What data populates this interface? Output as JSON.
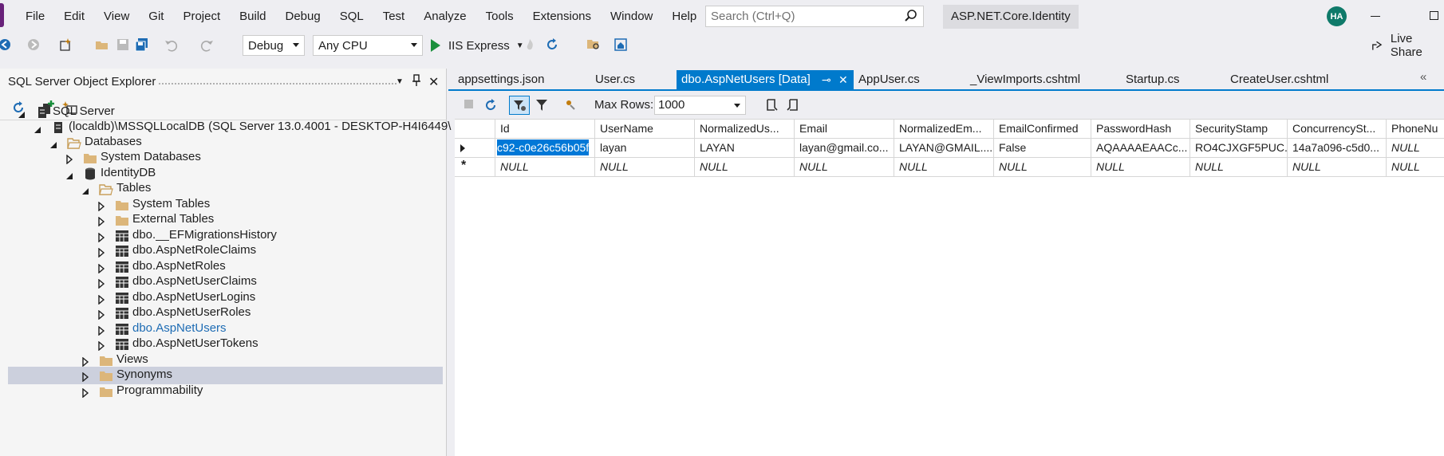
{
  "menu": {
    "items": [
      "File",
      "Edit",
      "View",
      "Git",
      "Project",
      "Build",
      "Debug",
      "SQL",
      "Test",
      "Analyze",
      "Tools",
      "Extensions",
      "Window",
      "Help"
    ],
    "search_placeholder": "Search (Ctrl+Q)",
    "solution_name": "ASP.NET.Core.Identity",
    "avatar_initials": "HA"
  },
  "toolbar": {
    "config": "Debug",
    "platform": "Any CPU",
    "run_target": "IIS Express",
    "live_share": "Live Share"
  },
  "explorer": {
    "title": "SQL Server Object Explorer",
    "tree": [
      {
        "label": "SQL Server",
        "level": 0,
        "icon": "server-icon",
        "state": "expanded"
      },
      {
        "label": "(localdb)\\MSSQLLocalDB (SQL Server 13.0.4001 - DESKTOP-H4I6449\\",
        "level": 1,
        "icon": "server-icon",
        "state": "expanded"
      },
      {
        "label": "Databases",
        "level": 2,
        "icon": "folder-open-icon",
        "state": "expanded"
      },
      {
        "label": "System Databases",
        "level": 3,
        "icon": "folder-icon",
        "state": "collapsed"
      },
      {
        "label": "IdentityDB",
        "level": 3,
        "icon": "database-icon",
        "state": "expanded"
      },
      {
        "label": "Tables",
        "level": 4,
        "icon": "folder-open-icon",
        "state": "expanded"
      },
      {
        "label": "System Tables",
        "level": 5,
        "icon": "folder-icon",
        "state": "collapsed"
      },
      {
        "label": "External Tables",
        "level": 5,
        "icon": "folder-icon",
        "state": "collapsed"
      },
      {
        "label": "dbo.__EFMigrationsHistory",
        "level": 5,
        "icon": "table-icon",
        "state": "collapsed"
      },
      {
        "label": "dbo.AspNetRoleClaims",
        "level": 5,
        "icon": "table-icon",
        "state": "collapsed"
      },
      {
        "label": "dbo.AspNetRoles",
        "level": 5,
        "icon": "table-icon",
        "state": "collapsed"
      },
      {
        "label": "dbo.AspNetUserClaims",
        "level": 5,
        "icon": "table-icon",
        "state": "collapsed"
      },
      {
        "label": "dbo.AspNetUserLogins",
        "level": 5,
        "icon": "table-icon",
        "state": "collapsed"
      },
      {
        "label": "dbo.AspNetUserRoles",
        "level": 5,
        "icon": "table-icon",
        "state": "collapsed"
      },
      {
        "label": "dbo.AspNetUsers",
        "level": 5,
        "icon": "table-icon",
        "state": "collapsed",
        "highlight": true
      },
      {
        "label": "dbo.AspNetUserTokens",
        "level": 5,
        "icon": "table-icon",
        "state": "collapsed"
      },
      {
        "label": "Views",
        "level": 4,
        "icon": "folder-icon",
        "state": "collapsed"
      },
      {
        "label": "Synonyms",
        "level": 4,
        "icon": "folder-icon",
        "state": "collapsed",
        "selected": true
      },
      {
        "label": "Programmability",
        "level": 4,
        "icon": "folder-icon",
        "state": "collapsed"
      }
    ]
  },
  "tabs": [
    {
      "label": "appsettings.json"
    },
    {
      "label": "User.cs"
    },
    {
      "label": "dbo.AspNetUsers [Data]",
      "active": true
    },
    {
      "label": "AppUser.cs"
    },
    {
      "label": "_ViewImports.cshtml"
    },
    {
      "label": "Startup.cs"
    },
    {
      "label": "CreateUser.cshtml"
    }
  ],
  "editor": {
    "max_rows_label": "Max Rows:",
    "max_rows_value": "1000",
    "columns": [
      "Id",
      "UserName",
      "NormalizedUs...",
      "Email",
      "NormalizedEm...",
      "EmailConfirmed",
      "PasswordHash",
      "SecurityStamp",
      "ConcurrencySt...",
      "PhoneNu"
    ],
    "rows": [
      [
        "c92-c0e26c56b05f",
        "layan",
        "LAYAN",
        "layan@gmail.co...",
        "LAYAN@GMAIL....",
        "False",
        "AQAAAAEAACc...",
        "RO4CJXGF5PUC...",
        "14a7a096-c5d0...",
        "NULL"
      ],
      [
        "NULL",
        "NULL",
        "NULL",
        "NULL",
        "NULL",
        "NULL",
        "NULL",
        "NULL",
        "NULL",
        "NULL"
      ]
    ]
  },
  "colors": {
    "accent": "#007acc",
    "selection": "#0078d7",
    "tree_selected": "#ccd0dd",
    "link": "#1e6cb4",
    "folder": "#dcb67a"
  }
}
